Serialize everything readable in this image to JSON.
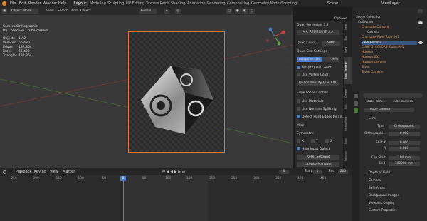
{
  "menubar": {
    "items": [
      "File",
      "Edit",
      "Render",
      "Window",
      "Help"
    ],
    "workspaces": [
      "Layout",
      "Modeling",
      "Sculpting",
      "UV Editing",
      "Texture Paint",
      "Shading",
      "Animation",
      "Rendering",
      "Compositing",
      "Geometry Nodes",
      "Scripting"
    ],
    "scene_label": "Scene",
    "viewlayer_label": "ViewLayer"
  },
  "viewport_header": {
    "mode": "Object Mode",
    "view": "View",
    "select": "Select",
    "add": "Add",
    "object": "Object",
    "transform": "Global",
    "options": "Options"
  },
  "viewport_info": {
    "title": "Camera Orthographic",
    "collection": "(0) Collection | cube camera",
    "stats": [
      [
        "Objects",
        "1 / 2"
      ],
      [
        "Vertices",
        "66,430"
      ],
      [
        "Edges",
        "132,864"
      ],
      [
        "Faces",
        "66,432"
      ],
      [
        "Triangles",
        "132,864"
      ]
    ]
  },
  "npanel": {
    "title": "Quad Remesher 1.2",
    "remesh": "<< REMESH IT >>",
    "quad_count_label": "Quad Count",
    "quad_count_value": "5000",
    "quad_size_settings": "Quad Size Settings",
    "adaptive_size": "Adaptive size",
    "adaptive_pct": "50%",
    "adapt_quad_count": "Adapt Quad Count",
    "use_vertex_color": "Use Vertex Color",
    "density_label": "Quads density (pai",
    "density_value": "1.00",
    "edge_loops_control": "Edge Loops Control",
    "use_materials": "Use Materials",
    "use_normals": "Use Normals Splitting",
    "detect_hard_edges": "Detect Hard Edges by an...",
    "misc": "Misc",
    "symmetry": "Symmetry:",
    "sym_x": "X",
    "sym_y": "Y",
    "sym_z": "Z",
    "hide_input": "Hide Input Object",
    "reset": "Reset Settings",
    "license": "License Manager"
  },
  "vtabs": [
    "Item",
    "Tool",
    "View",
    "Quad Remesh",
    "Create",
    "Edit",
    "RetopoFlow",
    "Bool",
    "Polygon"
  ],
  "outliner": {
    "header": "Scene Collection",
    "rows": [
      "Collection",
      "Charlotte Camera",
      "Camera",
      "Charlotte_Pipe_Tube.001",
      "cube camera",
      "CUBE_2_COLORS_Cube.001",
      "Hudson",
      "Hudson.002",
      "Hudson camera",
      "Teton",
      "Teton Camera"
    ]
  },
  "properties": {
    "search": "",
    "obj1": "cube cam...",
    "obj2": "cube camera",
    "data_name": "cube camera",
    "lens": "Lens",
    "type_label": "Type",
    "type_value": "Orthographic",
    "ortho_label": "Orthographi...",
    "ortho_value": "0.090",
    "shift_x_label": "Shift X",
    "shift_x_value": "0.000",
    "shift_y_label": "Y",
    "shift_y_value": "0.000",
    "clip_start_label": "Clip Start",
    "clip_start_value": "100 mm",
    "clip_end_label": "End",
    "clip_end_value": "100000 mm",
    "sections": [
      "Depth of Field",
      "Camera",
      "Safe Areas",
      "Background Images",
      "Viewport Display",
      "Custom Properties"
    ]
  },
  "timeline": {
    "playback": "Playback",
    "keying": "Keying",
    "view": "View",
    "marker": "Marker",
    "current": "0",
    "start_label": "Start",
    "start": "1",
    "end_label": "End",
    "end": "200",
    "ticks": [
      "-250",
      "-200",
      "-150",
      "-100",
      "-50",
      "0",
      "50",
      "100",
      "150",
      "200",
      "250",
      "300",
      "350",
      "400",
      "450"
    ]
  },
  "colors": {
    "accent": "#4a7fc8",
    "camera_frame": "#e07a2a",
    "active_tab": "#3d3d3d"
  }
}
